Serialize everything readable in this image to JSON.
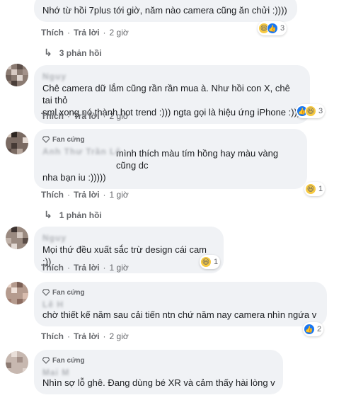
{
  "comments": [
    {
      "text": "Nhớ từ hồi 7plus tới giờ, năm nào camera cũng ăn chửi :))))",
      "actions": {
        "like": "Thích",
        "reply": "Trả lời",
        "time": "2 giờ"
      },
      "reactions": {
        "icons": [
          "haha-icon",
          "like-icon"
        ],
        "count": "3"
      },
      "replies_label": "3 phản hồi"
    },
    {
      "name": "Nguy",
      "text_lines": [
        "Chê camera dữ lắm cũng rần rần mua à. Như hồi con X, chê tai thỏ",
        "sml xong nó thành hot trend :))) ngta gọi là hiệu ứng iPhone :)))"
      ],
      "actions": {
        "like": "Thích",
        "reply": "Trả lời",
        "time": "2 giờ"
      },
      "reactions": {
        "icons": [
          "like-icon",
          "haha-icon"
        ],
        "count": "3"
      }
    },
    {
      "badge": "Fan cứng",
      "name": "Anh Thư Trần Lê",
      "text_lines": [
        "mình thích màu tím hồng hay màu vàng cũng dc",
        "nha bạn iu :)))))"
      ],
      "actions": {
        "like": "Thích",
        "reply": "Trả lời",
        "time": "1 giờ"
      },
      "reactions": {
        "icons": [
          "haha-icon"
        ],
        "count": "1"
      },
      "replies_label": "1 phản hồi"
    },
    {
      "name": "Nguy",
      "text": "Mọi thứ đều xuất sắc trừ design cái cam :))",
      "actions": {
        "like": "Thích",
        "reply": "Trả lời",
        "time": "1 giờ"
      },
      "reactions": {
        "icons": [
          "haha-icon"
        ],
        "count": "1"
      }
    },
    {
      "badge": "Fan cứng",
      "name": "Lê H",
      "text": "chờ thiết kế năm sau cải tiến ntn chứ năm nay camera nhìn ngứa v",
      "actions": {
        "like": "Thích",
        "reply": "Trả lời",
        "time": "2 giờ"
      },
      "reactions": {
        "icons": [
          "like-icon"
        ],
        "count": "2"
      }
    },
    {
      "badge": "Fan cứng",
      "name": "Mai M",
      "text": "Nhìn sợ lỗ ghê. Đang dùng bé XR và cảm thấy hài lòng v"
    }
  ],
  "colors": {
    "bubble": "#f0f2f5",
    "meta": "#65676b",
    "like": "#1877f2",
    "haha": "#f7c940"
  }
}
